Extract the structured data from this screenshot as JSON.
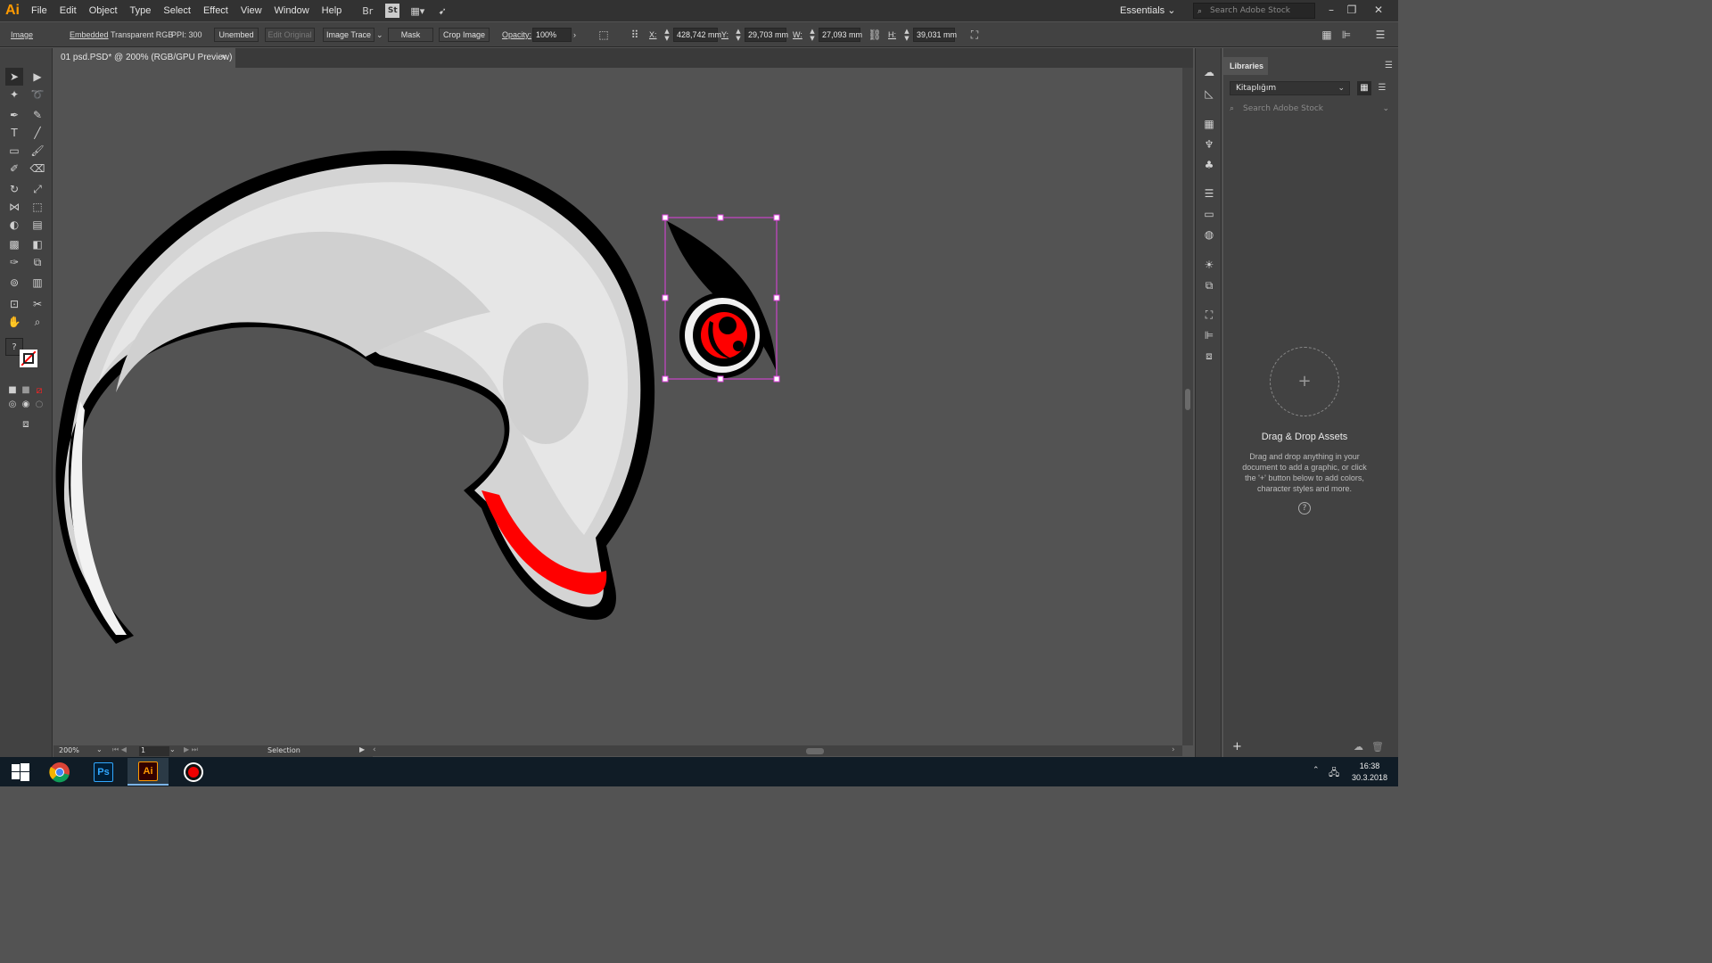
{
  "app": {
    "logo": "Ai",
    "accent": "#ff9a00"
  },
  "menu": [
    "File",
    "Edit",
    "Object",
    "Type",
    "Select",
    "Effect",
    "View",
    "Window",
    "Help"
  ],
  "menubar_icons": {
    "bridge": "Br",
    "stock": "St"
  },
  "workspace": "Essentials",
  "search_stock_placeholder": "Search Adobe Stock",
  "control": {
    "object_type": "Image",
    "embedded": "Embedded",
    "color_mode": "Transparent RGB",
    "ppi": "PPI: 300",
    "unembed": "Unembed",
    "edit_original": "Edit Original",
    "image_trace": "Image Trace",
    "mask": "Mask",
    "crop": "Crop Image",
    "opacity_label": "Opacity:",
    "opacity_value": "100%",
    "x_label": "X:",
    "x_value": "428,742 mm",
    "y_label": "Y:",
    "y_value": "29,703 mm",
    "w_label": "W:",
    "w_value": "27,093 mm",
    "h_label": "H:",
    "h_value": "39,031 mm"
  },
  "document_tab": {
    "title": "01 psd.PSD* @ 200% (RGB/GPU Preview)",
    "close": "×"
  },
  "status": {
    "zoom": "200%",
    "artboard": "1",
    "tool": "Selection"
  },
  "libraries": {
    "tab": "Libraries",
    "library_name": "Kitaplığım",
    "search_placeholder": "Search Adobe Stock",
    "drop_title": "Drag & Drop Assets",
    "drop_desc": "Drag and drop anything in your document to add a graphic, or click the '+' button below to add colors, character styles and more.",
    "help": "?",
    "plus": "+"
  },
  "taskbar": {
    "apps": [
      {
        "name": "Photoshop",
        "label": "Ps",
        "color": "#31a8ff",
        "bg": "#001e36"
      },
      {
        "name": "Illustrator",
        "label": "Ai",
        "color": "#ff9a00",
        "bg": "#330000"
      }
    ],
    "time": "16:38",
    "date": "30.3.2018"
  },
  "colors": {
    "selection": "#e040e0",
    "red": "#ff0000"
  }
}
